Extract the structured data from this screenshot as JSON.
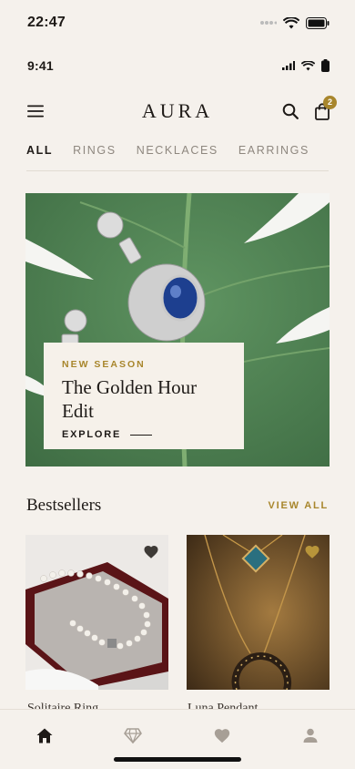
{
  "status_bar_outer": {
    "time": "22:47"
  },
  "status_bar_inner": {
    "time": "9:41"
  },
  "header": {
    "brand": "AURA",
    "cart_count": "2"
  },
  "categories": [
    {
      "label": "ALL",
      "active": true
    },
    {
      "label": "RINGS",
      "active": false
    },
    {
      "label": "NECKLACES",
      "active": false
    },
    {
      "label": "EARRINGS",
      "active": false
    }
  ],
  "hero": {
    "eyebrow": "NEW SEASON",
    "title": "The Golden Hour Edit",
    "cta": "EXPLORE"
  },
  "bestsellers": {
    "title": "Bestsellers",
    "view_all": "VIEW ALL",
    "products": [
      {
        "name": "Solitaire Ring"
      },
      {
        "name": "Luna Pendant"
      }
    ]
  },
  "tabbar": {
    "items": [
      "home-icon",
      "diamond-icon",
      "heart-icon",
      "profile-icon"
    ]
  },
  "colors": {
    "accent": "#a8862c",
    "background": "#f5f1ec",
    "text": "#1e1a17"
  }
}
